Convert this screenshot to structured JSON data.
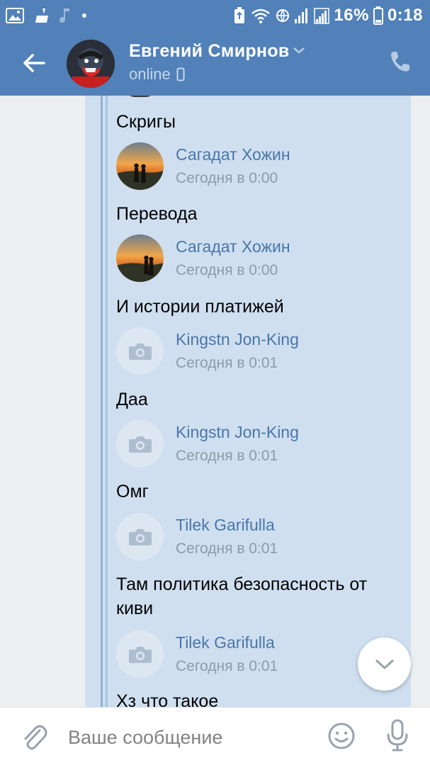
{
  "status_bar": {
    "battery_percent": "16%",
    "time": "0:18",
    "icons": [
      "image-icon",
      "cleaner-icon",
      "music-icon",
      "dot-icon",
      "recycle-icon",
      "wifi-icon",
      "vpn-icon",
      "signal-icon",
      "signal-icon",
      "battery-icon"
    ]
  },
  "header": {
    "name": "Евгений Смирнов",
    "status": "online",
    "icons": [
      "back-arrow-icon",
      "chevron-down-icon",
      "mobile-icon",
      "phone-icon"
    ]
  },
  "forwarded": [
    {
      "type": "text",
      "text": "Скригы"
    },
    {
      "type": "author",
      "name": "Сагадат Хожин",
      "time": "Сегодня в 0:00",
      "avatar": "photo"
    },
    {
      "type": "text",
      "text": "Перевода"
    },
    {
      "type": "author",
      "name": "Сагадат Хожин",
      "time": "Сегодня в 0:00",
      "avatar": "photo"
    },
    {
      "type": "text",
      "text": "И истории платижей"
    },
    {
      "type": "author",
      "name": "Kingstn Jon-King",
      "time": "Сегодня в 0:01",
      "avatar": "camera"
    },
    {
      "type": "text",
      "text": "Даа"
    },
    {
      "type": "author",
      "name": "Kingstn Jon-King",
      "time": "Сегодня в 0:01",
      "avatar": "camera"
    },
    {
      "type": "text",
      "text": "Омг"
    },
    {
      "type": "author",
      "name": "Tilek Garifulla",
      "time": "Сегодня в 0:01",
      "avatar": "camera"
    },
    {
      "type": "text",
      "text": "Там политика безопасность от киви"
    },
    {
      "type": "author",
      "name": "Tilek Garifulla",
      "time": "Сегодня в 0:01",
      "avatar": "camera"
    },
    {
      "type": "text",
      "text": "Хз что такое"
    }
  ],
  "input": {
    "placeholder": "Ваше сообщение"
  },
  "colors": {
    "header_bg": "#5181b8",
    "bubble_bg": "#cfdff0",
    "author_name": "#4a76a8",
    "time": "#8e9aa6"
  }
}
